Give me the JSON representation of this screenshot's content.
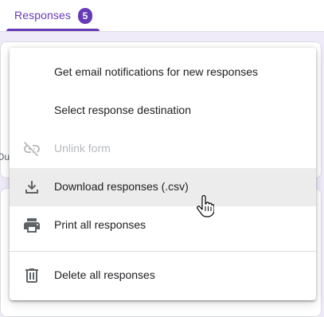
{
  "tab": {
    "label": "Responses",
    "count": "5"
  },
  "background": {
    "partial_text": "Oue"
  },
  "menu": {
    "items": [
      {
        "label": "Get email notifications for new responses",
        "icon": "none",
        "enabled": true
      },
      {
        "label": "Select response destination",
        "icon": "none",
        "enabled": true
      },
      {
        "label": "Unlink form",
        "icon": "link-off-icon",
        "enabled": false
      },
      {
        "label": "Download responses (.csv)",
        "icon": "download-icon",
        "enabled": true,
        "hovered": true
      },
      {
        "label": "Print all responses",
        "icon": "print-icon",
        "enabled": true
      },
      {
        "label": "Delete all responses",
        "icon": "trash-icon",
        "enabled": true
      }
    ]
  },
  "colors": {
    "accent": "#673ab7",
    "hover_bg": "#ececec",
    "disabled_text": "#b7b9bc",
    "page_bg": "#f0ebf8"
  }
}
